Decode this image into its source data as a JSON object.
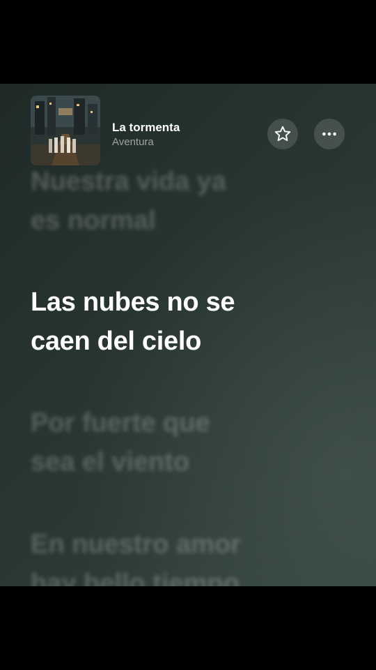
{
  "now_playing": {
    "title": "La tormenta",
    "artist": "Aventura"
  },
  "buttons": {
    "favorite_icon": "star-icon",
    "more_icon": "ellipsis-icon"
  },
  "lyrics": {
    "previous": [
      "Nuestra vida ya",
      "es normal"
    ],
    "current": [
      "Las nubes no se",
      "caen del cielo"
    ],
    "next1": [
      "Por fuerte que",
      "sea el viento"
    ],
    "next2": [
      "En nuestro amor",
      "hay bello tiempo"
    ]
  },
  "colors": {
    "background": "#2a3733",
    "text_active": "#ffffff",
    "text_dim": "rgba(255,255,255,0.22)"
  }
}
